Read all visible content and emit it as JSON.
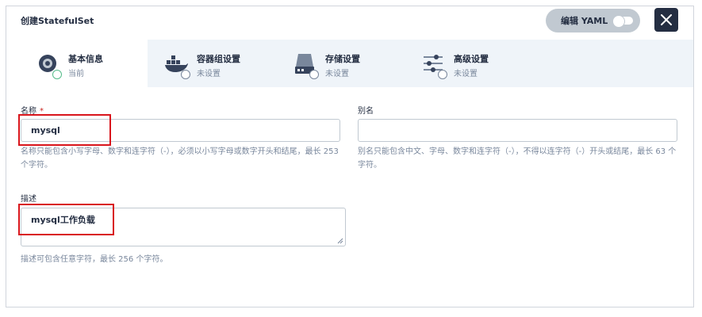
{
  "dialog": {
    "title": "创建StatefulSet",
    "yaml_label": "编辑 YAML"
  },
  "steps": [
    {
      "name": "基本信息",
      "status": "当前",
      "icon": "basic-info-icon"
    },
    {
      "name": "容器组设置",
      "status": "未设置",
      "icon": "docker-icon"
    },
    {
      "name": "存储设置",
      "status": "未设置",
      "icon": "storage-icon"
    },
    {
      "name": "高级设置",
      "status": "未设置",
      "icon": "sliders-icon"
    }
  ],
  "form": {
    "name_label": "名称",
    "required_mark": "*",
    "name_value": "mysql",
    "name_help": "名称只能包含小写字母、数字和连字符（-），必须以小写字母或数字开头和结尾，最长 253 个字符。",
    "alias_label": "别名",
    "alias_value": "",
    "alias_help": "别名只能包含中文、字母、数字和连字符（-），不得以连字符（-）开头或结尾，最长 63 个字符。",
    "desc_label": "描述",
    "desc_value": "mysql工作负载",
    "desc_help": "描述可包含任意字符，最长 256 个字符。"
  },
  "colors": {
    "accent": "#242e42",
    "highlight": "#d9151c",
    "success": "#55bc8a"
  }
}
